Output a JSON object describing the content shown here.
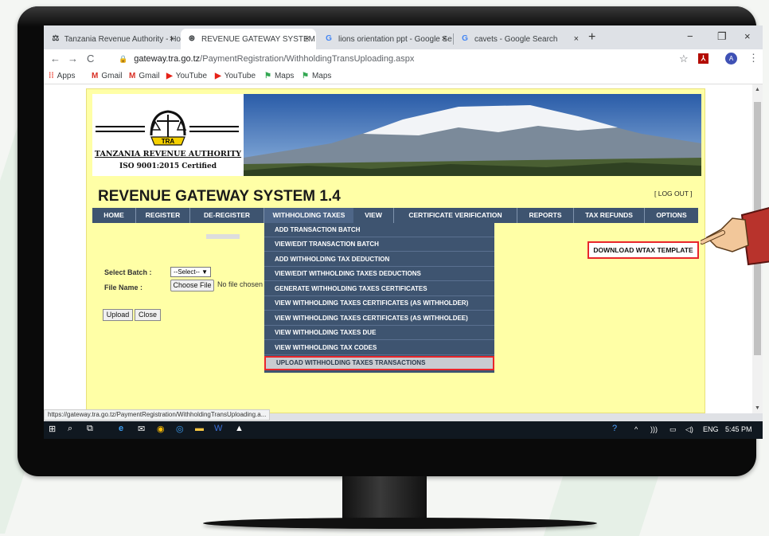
{
  "browser": {
    "tabs": [
      {
        "title": "Tanzania Revenue Authority - Ho",
        "icon": "tra-favicon-icon",
        "close": "×"
      },
      {
        "title": "REVENUE GATEWAY SYSTEM",
        "icon": "globe-icon",
        "close": "×"
      },
      {
        "title": "lions orientation ppt - Google Se",
        "icon": "google-icon",
        "close": "×"
      },
      {
        "title": "cavets - Google Search",
        "icon": "google-icon",
        "close": "×"
      }
    ],
    "new_tab": "+",
    "win_min": "−",
    "win_max": "❐",
    "win_close": "×",
    "nav_back": "←",
    "nav_forward": "→",
    "nav_reload": "C",
    "url_domain": "gateway.tra.go.tz",
    "url_path": "/PaymentRegistration/WithholdingTransUploading.aspx",
    "star": "☆",
    "avatar_letter": "A",
    "menu": "⋮",
    "bookmarks": [
      {
        "label": "Apps",
        "icon": "apps-grid-icon"
      },
      {
        "label": "Gmail",
        "icon": "gmail-icon"
      },
      {
        "label": "Gmail",
        "icon": "gmail-icon"
      },
      {
        "label": "YouTube",
        "icon": "youtube-icon"
      },
      {
        "label": "YouTube",
        "icon": "youtube-icon"
      },
      {
        "label": "Maps",
        "icon": "maps-icon"
      },
      {
        "label": "Maps",
        "icon": "maps-icon"
      }
    ],
    "status_url": "https://gateway.tra.go.tz/PaymentRegistration/WithholdingTransUploading.a..."
  },
  "site": {
    "org_name": "TANZANIA REVENUE AUTHORITY",
    "iso": "ISO 9001:2015 Certified",
    "logo_badge": "TRA",
    "system_title": "REVENUE GATEWAY SYSTEM 1.4",
    "logout": "[ LOG OUT ]",
    "nav": [
      "HOME",
      "REGISTER",
      "DE-REGISTER",
      "WITHHOLDING TAXES",
      "VIEW",
      "CERTIFICATE VERIFICATION",
      "REPORTS",
      "TAX REFUNDS",
      "OPTIONS"
    ],
    "dropdown": [
      "ADD TRANSACTION BATCH",
      "VIEW/EDIT TRANSACTION BATCH",
      "ADD WITHHOLDING TAX DEDUCTION",
      "VIEW/EDIT WITHHOLDING TAXES DEDUCTIONS",
      "GENERATE WITHHOLDING TAXES CERTIFICATES",
      "VIEW WITHHOLDING TAXES CERTIFICATES (AS WITHHOLDER)",
      "VIEW WITHHOLDING TAXES CERTIFICATES (AS WITHHOLDEE)",
      "VIEW WITHHOLDING TAXES DUE",
      "VIEW WITHHOLDING TAX CODES",
      "UPLOAD WITHHOLDING TAXES TRANSACTIONS"
    ],
    "download_template": "DOWNLOAD WTAX TEMPLATE",
    "form": {
      "select_batch_label": "Select Batch :",
      "select_batch_value": "--Select-- ▼",
      "file_name_label": "File Name :",
      "choose_file": "Choose File",
      "no_file": "No file chosen",
      "upload": "Upload",
      "close": "Close"
    }
  },
  "taskbar": {
    "lang": "ENG",
    "time": "5:45 PM"
  },
  "colors": {
    "page_bg": "#ffffa6",
    "nav_bg": "#3e5470",
    "highlight_red": "#e8262b"
  }
}
